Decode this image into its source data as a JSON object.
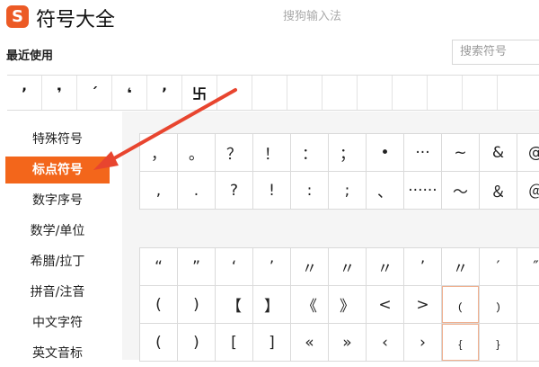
{
  "header": {
    "logo_glyph": "S",
    "title": "符号大全",
    "ime_name": "搜狗输入法"
  },
  "recent": {
    "label": "最近使用",
    "symbols": [
      "’",
      "❜",
      "ˊ",
      "❛",
      "’",
      "卐",
      "",
      "",
      "",
      "",
      "",
      "",
      "",
      ""
    ]
  },
  "search": {
    "placeholder": "搜索符号"
  },
  "sidebar": {
    "items": [
      {
        "label": "特殊符号",
        "active": false
      },
      {
        "label": "标点符号",
        "active": true
      },
      {
        "label": "数字序号",
        "active": false
      },
      {
        "label": "数学/单位",
        "active": false
      },
      {
        "label": "希腊/拉丁",
        "active": false
      },
      {
        "label": "拼音/注音",
        "active": false
      },
      {
        "label": "中文字符",
        "active": false
      },
      {
        "label": "英文音标",
        "active": false
      }
    ]
  },
  "punctuation": {
    "group1": [
      [
        "，",
        "。",
        "？",
        "！",
        "：",
        "；",
        "•",
        "···",
        "~",
        "&",
        "@"
      ],
      [
        ",",
        ".",
        "?",
        "!",
        ":",
        ";",
        "、",
        "······",
        "～",
        "＆",
        "＠"
      ]
    ],
    "group2": [
      [
        "“",
        "”",
        "‘",
        "’",
        "〃",
        "〃",
        "〃",
        "’",
        "〃",
        "′",
        "″"
      ],
      [
        "(",
        ")",
        "【",
        "】",
        "《",
        "》",
        "<",
        ">",
        "﹙",
        "﹚",
        ""
      ],
      [
        "(",
        ")",
        "[",
        "]",
        "«",
        "»",
        "‹",
        "›",
        "﹛",
        "﹜",
        ""
      ]
    ]
  },
  "colors": {
    "accent": "#f3661b",
    "arrow": "#e8452f",
    "logo": "#ec5a25"
  }
}
